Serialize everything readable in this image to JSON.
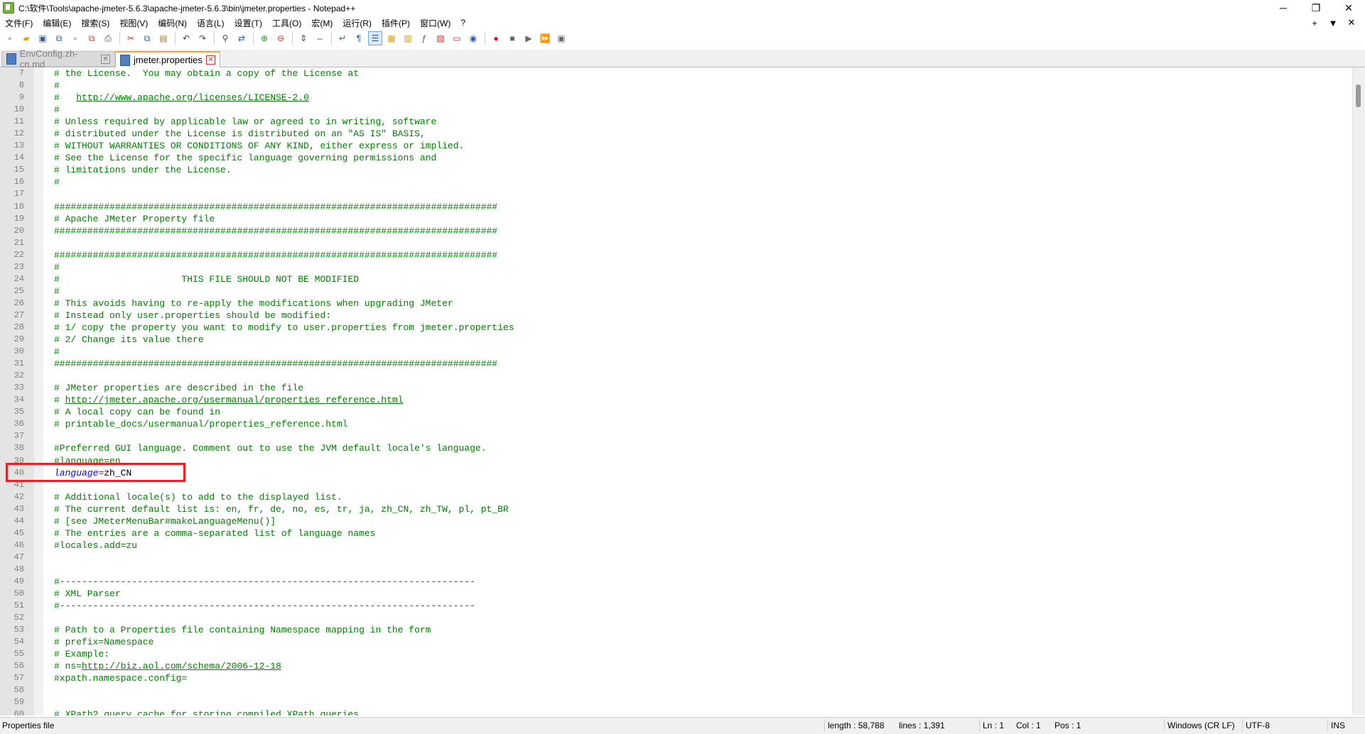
{
  "window": {
    "title": "C:\\软件\\Tools\\apache-jmeter-5.6.3\\apache-jmeter-5.6.3\\bin\\jmeter.properties - Notepad++",
    "minimize": "─",
    "maximize": "❐",
    "close": "✕"
  },
  "menu": {
    "items": [
      "文件(F)",
      "编辑(E)",
      "搜索(S)",
      "视图(V)",
      "编码(N)",
      "语言(L)",
      "设置(T)",
      "工具(O)",
      "宏(M)",
      "运行(R)",
      "插件(P)",
      "窗口(W)",
      "?"
    ],
    "right": [
      "+",
      "▼",
      "✕"
    ]
  },
  "toolbar": {
    "icons": [
      "new-file-icon",
      "open-file-icon",
      "save-icon",
      "save-all-icon",
      "close-icon",
      "close-all-icon",
      "print-icon",
      "cut-icon",
      "copy-icon",
      "paste-icon",
      "undo-icon",
      "redo-icon",
      "find-icon",
      "replace-icon",
      "zoom-in-icon",
      "zoom-out-icon",
      "sync-vertical-icon",
      "sync-horizontal-icon",
      "word-wrap-icon",
      "show-all-chars-icon",
      "indent-guide-icon",
      "udl-icon",
      "doc-map-icon",
      "function-list-icon",
      "folder-workspace-icon",
      "doc-list-icon",
      "monitoring-icon",
      "record-macro-icon",
      "stop-macro-icon",
      "play-macro-icon",
      "run-macro-multiple-icon",
      "save-macro-icon"
    ]
  },
  "tabs": [
    {
      "label": "EnvConfig.zh-cn.md",
      "active": false
    },
    {
      "label": "jmeter.properties",
      "active": true
    }
  ],
  "editor": {
    "lines": [
      {
        "n": "7",
        "t": "# the License.  You may obtain a copy of the License at"
      },
      {
        "n": "8",
        "t": "#"
      },
      {
        "n": "9",
        "t": "#   ",
        "url": "http://www.apache.org/licenses/LICENSE-2.0"
      },
      {
        "n": "10",
        "t": "#"
      },
      {
        "n": "11",
        "t": "# Unless required by applicable law or agreed to in writing, software"
      },
      {
        "n": "12",
        "t": "# distributed under the License is distributed on an \"AS IS\" BASIS,"
      },
      {
        "n": "13",
        "t": "# WITHOUT WARRANTIES OR CONDITIONS OF ANY KIND, either express or implied."
      },
      {
        "n": "14",
        "t": "# See the License for the specific language governing permissions and"
      },
      {
        "n": "15",
        "t": "# limitations under the License."
      },
      {
        "n": "16",
        "t": "#"
      },
      {
        "n": "17",
        "t": ""
      },
      {
        "n": "18",
        "t": "################################################################################"
      },
      {
        "n": "19",
        "t": "# Apache JMeter Property file"
      },
      {
        "n": "20",
        "t": "################################################################################"
      },
      {
        "n": "21",
        "t": ""
      },
      {
        "n": "22",
        "t": "################################################################################"
      },
      {
        "n": "23",
        "t": "#"
      },
      {
        "n": "24",
        "t": "#                      THIS FILE SHOULD NOT BE MODIFIED"
      },
      {
        "n": "25",
        "t": "#"
      },
      {
        "n": "26",
        "t": "# This avoids having to re-apply the modifications when upgrading JMeter"
      },
      {
        "n": "27",
        "t": "# Instead only user.properties should be modified:"
      },
      {
        "n": "28",
        "t": "# 1/ copy the property you want to modify to user.properties from jmeter.properties"
      },
      {
        "n": "29",
        "t": "# 2/ Change its value there"
      },
      {
        "n": "30",
        "t": "#"
      },
      {
        "n": "31",
        "t": "################################################################################"
      },
      {
        "n": "32",
        "t": ""
      },
      {
        "n": "33",
        "t": "# JMeter properties are described in the file"
      },
      {
        "n": "34",
        "t": "# ",
        "url": "http://jmeter.apache.org/usermanual/properties_reference.html"
      },
      {
        "n": "35",
        "t": "# A local copy can be found in"
      },
      {
        "n": "36",
        "t": "# printable_docs/usermanual/properties_reference.html"
      },
      {
        "n": "37",
        "t": ""
      },
      {
        "n": "38",
        "t": "#Preferred GUI language. Comment out to use the JVM default locale's language."
      },
      {
        "n": "39",
        "t": "#language=en"
      },
      {
        "n": "40",
        "key": "language",
        "eq": "=",
        "val": "zh_CN"
      },
      {
        "n": "41",
        "t": ""
      },
      {
        "n": "42",
        "t": "# Additional locale(s) to add to the displayed list."
      },
      {
        "n": "43",
        "t": "# The current default list is: en, fr, de, no, es, tr, ja, zh_CN, zh_TW, pl, pt_BR"
      },
      {
        "n": "44",
        "t": "# [see JMeterMenuBar#makeLanguageMenu()]"
      },
      {
        "n": "45",
        "t": "# The entries are a comma-separated list of language names"
      },
      {
        "n": "46",
        "t": "#locales.add=zu"
      },
      {
        "n": "47",
        "t": ""
      },
      {
        "n": "48",
        "t": ""
      },
      {
        "n": "49",
        "t": "#---------------------------------------------------------------------------"
      },
      {
        "n": "50",
        "t": "# XML Parser"
      },
      {
        "n": "51",
        "t": "#---------------------------------------------------------------------------"
      },
      {
        "n": "52",
        "t": ""
      },
      {
        "n": "53",
        "t": "# Path to a Properties file containing Namespace mapping in the form"
      },
      {
        "n": "54",
        "t": "# prefix=Namespace"
      },
      {
        "n": "55",
        "t": "# Example:"
      },
      {
        "n": "56",
        "t": "# ns=",
        "url": "http://biz.aol.com/schema/2006-12-18"
      },
      {
        "n": "57",
        "t": "#xpath.namespace.config="
      },
      {
        "n": "58",
        "t": ""
      },
      {
        "n": "59",
        "t": ""
      },
      {
        "n": "60",
        "t": "# XPath2 query cache for storing compiled XPath queries"
      }
    ]
  },
  "status": {
    "file_type": "Properties file",
    "length": "length : 58,788",
    "lines": "lines : 1,391",
    "ln": "Ln : 1",
    "col": "Col : 1",
    "pos": "Pos : 1",
    "eol": "Windows (CR LF)",
    "encoding": "UTF-8",
    "mode": "INS"
  },
  "colors": {
    "comment": "#008000",
    "keyword": "#0000ff",
    "operator": "#ff0000",
    "highlight_box": "#e8202a",
    "active_tab_accent": "#f5a13b"
  }
}
